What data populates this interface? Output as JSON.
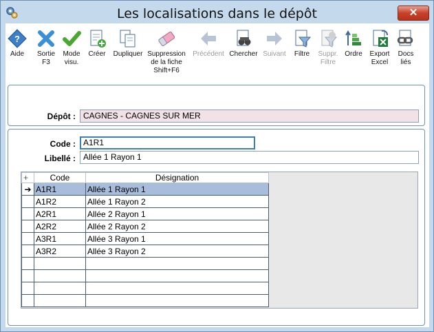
{
  "window": {
    "title": "Les localisations dans le dépôt",
    "close_label": "✕"
  },
  "toolbar": [
    {
      "name": "help-button",
      "icon": "help-icon",
      "label": "Aide",
      "enabled": true
    },
    {
      "name": "exit-button",
      "icon": "close-x-icon",
      "label": "Sortie\nF3",
      "enabled": true
    },
    {
      "name": "view-mode-button",
      "icon": "checkmark-icon",
      "label": "Mode\nvisu.",
      "enabled": true
    },
    {
      "name": "create-button",
      "icon": "new-document-icon",
      "label": "Créer",
      "enabled": true
    },
    {
      "name": "duplicate-button",
      "icon": "duplicate-icon",
      "label": "Dupliquer",
      "enabled": true
    },
    {
      "name": "delete-record-button",
      "icon": "eraser-icon",
      "label": "Suppression\nde la fiche\nShift+F6",
      "enabled": true
    },
    {
      "name": "previous-button",
      "icon": "arrow-left-icon",
      "label": "Précédent",
      "enabled": false
    },
    {
      "name": "search-button",
      "icon": "binoculars-icon",
      "label": "Chercher",
      "enabled": true
    },
    {
      "name": "next-button",
      "icon": "arrow-right-icon",
      "label": "Suivant",
      "enabled": false
    },
    {
      "name": "filter-button",
      "icon": "filter-icon",
      "label": "Filtre",
      "enabled": true
    },
    {
      "name": "remove-filter-button",
      "icon": "filter-remove-icon",
      "label": "Suppr.\nFiltre",
      "enabled": false
    },
    {
      "name": "order-button",
      "icon": "sort-icon",
      "label": "Ordre",
      "enabled": true
    },
    {
      "name": "export-excel-button",
      "icon": "excel-export-icon",
      "label": "Export\nExcel",
      "enabled": true
    },
    {
      "name": "linked-docs-button",
      "icon": "chain-link-icon",
      "label": "Docs\nliés",
      "enabled": true
    }
  ],
  "depot": {
    "label": "Dépôt :",
    "value": "CAGNES - CAGNES SUR MER"
  },
  "form": {
    "code_label": "Code :",
    "code_value": "A1R1",
    "libelle_label": "Libellé :",
    "libelle_value": "Allée 1 Rayon 1"
  },
  "grid": {
    "add_symbol": "+",
    "columns": [
      "Code",
      "Désignation"
    ],
    "selected_marker": "➔",
    "rows": [
      {
        "code": "A1R1",
        "designation": "Allée 1 Rayon 1",
        "selected": true
      },
      {
        "code": "A1R2",
        "designation": "Allée 1 Rayon 2",
        "selected": false
      },
      {
        "code": "A2R1",
        "designation": "Allée 2 Rayon 1",
        "selected": false
      },
      {
        "code": "A2R2",
        "designation": "Allée 2 Rayon 2",
        "selected": false
      },
      {
        "code": "A3R1",
        "designation": "Allée 3 Rayon 1",
        "selected": false
      },
      {
        "code": "A3R2",
        "designation": "Allée 3 Rayon 2",
        "selected": false
      },
      {
        "code": "",
        "designation": "",
        "selected": false
      },
      {
        "code": "",
        "designation": "",
        "selected": false
      },
      {
        "code": "",
        "designation": "",
        "selected": false
      },
      {
        "code": "",
        "designation": "",
        "selected": false
      }
    ]
  }
}
